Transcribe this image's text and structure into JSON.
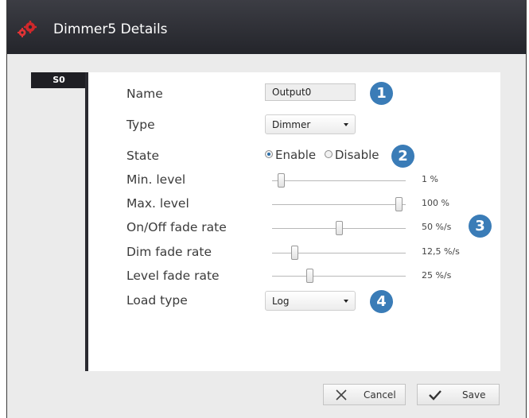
{
  "window": {
    "title": "Dimmer5 Details"
  },
  "tab": {
    "label": "S0"
  },
  "fields": {
    "name": {
      "label": "Name",
      "value": "Output0"
    },
    "type": {
      "label": "Type",
      "value": "Dimmer"
    },
    "state": {
      "label": "State",
      "options": [
        "Enable",
        "Disable"
      ],
      "selected": "Enable"
    },
    "load_type": {
      "label": "Load type",
      "value": "Log"
    }
  },
  "sliders": [
    {
      "label": "Min. level",
      "value_text": "1 %",
      "position": 0.01
    },
    {
      "label": "Max. level",
      "value_text": "100 %",
      "position": 1.0
    },
    {
      "label": "On/Off fade rate",
      "value_text": "50 %/s",
      "position": 0.5
    },
    {
      "label": "Dim fade rate",
      "value_text": "12,5 %/s",
      "position": 0.125
    },
    {
      "label": "Level fade rate",
      "value_text": "25 %/s",
      "position": 0.25
    }
  ],
  "badges": [
    "1",
    "2",
    "3",
    "4"
  ],
  "buttons": {
    "cancel": "Cancel",
    "save": "Save"
  },
  "colors": {
    "badge": "#3a7cb7",
    "titlebar": "#2f3036",
    "icon_accent": "#d0282b"
  }
}
